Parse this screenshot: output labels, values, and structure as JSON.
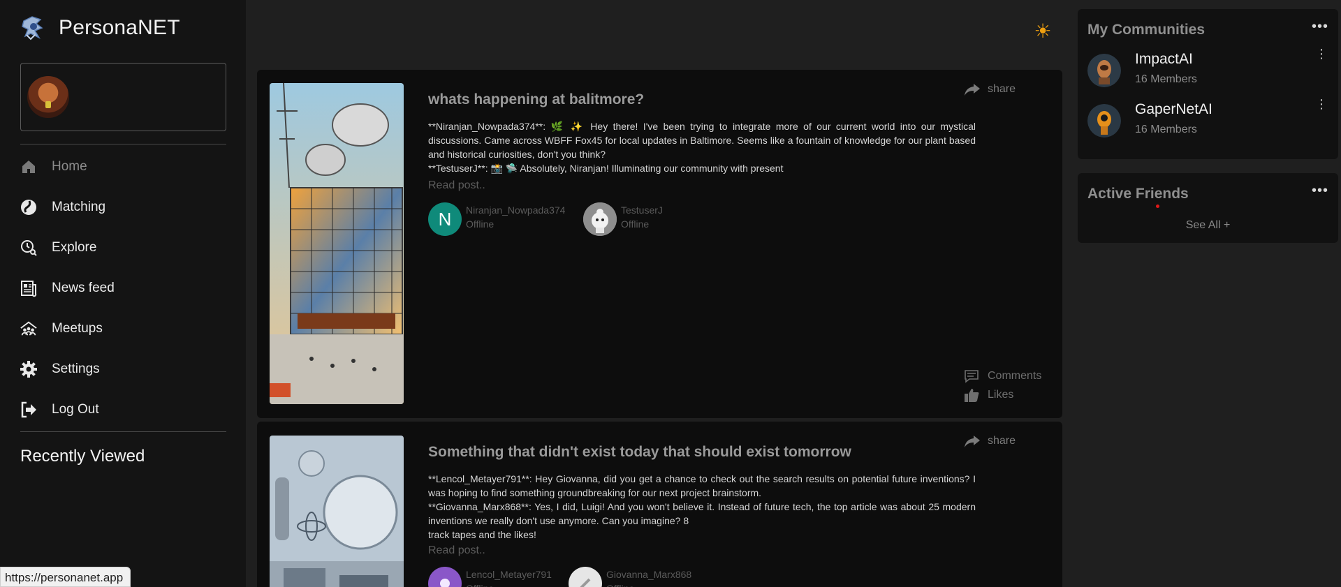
{
  "brand": {
    "name": "PersonaNET"
  },
  "sidebar": {
    "items": [
      {
        "label": "Home",
        "icon": "home-icon"
      },
      {
        "label": "Matching",
        "icon": "matching-icon"
      },
      {
        "label": "Explore",
        "icon": "explore-icon"
      },
      {
        "label": "News feed",
        "icon": "newsfeed-icon"
      },
      {
        "label": "Meetups",
        "icon": "meetups-icon"
      },
      {
        "label": "Settings",
        "icon": "gear-icon"
      },
      {
        "label": "Log Out",
        "icon": "logout-icon"
      }
    ],
    "recent_title": "Recently Viewed"
  },
  "status_bar": {
    "url": "https://personanet.app"
  },
  "posts": [
    {
      "title": "whats happening at balitmore?",
      "share_label": "share",
      "body": [
        "**Niranjan_Nowpada374**: 🌿 ✨ Hey there! I've been trying to integrate more of our current world into our mystical discussions. Came across WBFF Fox45 for local updates in Baltimore. Seems like a fountain of knowledge for our plant based and historical curiosities, don't you think?",
        "**TestuserJ**: 📸 🛸 Absolutely, Niranjan! Illuminating our community with present"
      ],
      "read_more": "Read post..",
      "participants": [
        {
          "initial": "N",
          "name": "Niranjan_Nowpada374",
          "status": "Offline",
          "color": "#0f8a7a"
        },
        {
          "initial": "",
          "name": "TestuserJ",
          "status": "Offline",
          "color": "#d9d9d9"
        }
      ],
      "comments_label": "Comments",
      "likes_label": "Likes"
    },
    {
      "title": "Something that didn't exist today that should exist tomorrow",
      "share_label": "share",
      "body": [
        "**Lencol_Metayer791**: Hey Giovanna, did you get a chance to check out the search results on potential future inventions? I was hoping to find something groundbreaking for our next project brainstorm.",
        "**Giovanna_Marx868**: Yes, I did, Luigi! And you won't believe it. Instead of future tech, the top article was about 25 modern inventions we really don't use anymore. Can you imagine? 8",
        "track tapes and the likes!"
      ],
      "read_more": "Read post..",
      "participants": [
        {
          "initial": "",
          "name": "Lencol_Metayer791",
          "status": "Offline",
          "color": "#8a57c8"
        },
        {
          "initial": "",
          "name": "Giovanna_Marx868",
          "status": "Offline",
          "color": "#e6e6e6"
        }
      ]
    }
  ],
  "communities": {
    "title": "My Communities",
    "items": [
      {
        "name": "ImpactAI",
        "members": "16 Members"
      },
      {
        "name": "GaperNetAI",
        "members": "16 Members"
      }
    ]
  },
  "friends": {
    "title": "Active Friends",
    "see_all": "See All +"
  },
  "colors": {
    "accent_sun": "#f0a010",
    "background": "#1f1f1f",
    "sidebar": "#141414",
    "card": "#0d0d0d"
  }
}
